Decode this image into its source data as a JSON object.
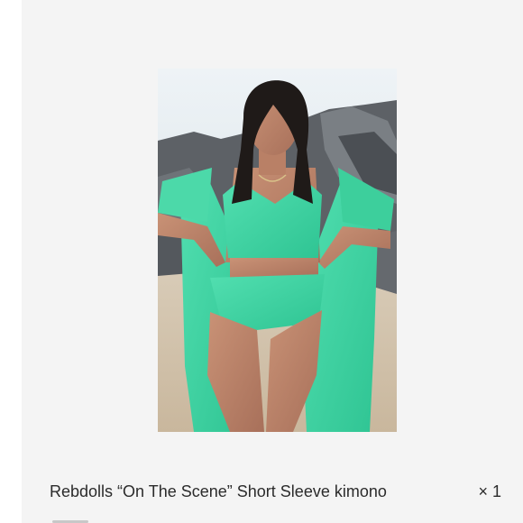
{
  "product": {
    "image_alt": "Rebdolls On The Scene Short Sleeve kimono worn with matching mint bikini on a rocky beach",
    "title": "Rebdolls “On The Scene” Short Sleeve kimono",
    "quantity": "× 1"
  },
  "colors": {
    "background": "#f4f4f4",
    "garment": "#43d6a4",
    "text": "#2b2b2b"
  }
}
